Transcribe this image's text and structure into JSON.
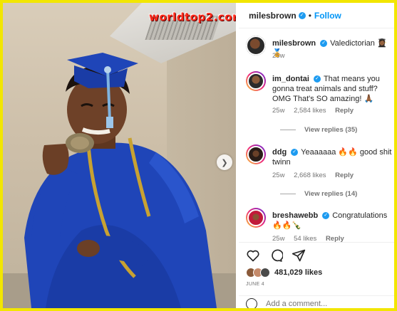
{
  "watermark": "worldtop2.com",
  "post": {
    "author": "milesbrown",
    "follow_label": "Follow",
    "separator": "•"
  },
  "comments": [
    {
      "user": "milesbrown",
      "text": "Valedictorian 👩🏾‍🎓🏅",
      "time": "25w",
      "likes": "",
      "reply": "",
      "view_replies": ""
    },
    {
      "user": "im_dontai",
      "text": "That means you gonna treat animals and stuff? OMG That's SO amazing! 🙏🏾",
      "time": "25w",
      "likes": "2,584 likes",
      "reply": "Reply",
      "view_replies": "View replies (35)"
    },
    {
      "user": "ddg",
      "text": "Yeaaaaaa 🔥🔥 good shit twinn",
      "time": "25w",
      "likes": "2,668 likes",
      "reply": "Reply",
      "view_replies": "View replies (14)"
    },
    {
      "user": "breshawebb",
      "text": "Congratulations 🔥🔥🍾",
      "time": "25w",
      "likes": "54 likes",
      "reply": "Reply",
      "view_replies": ""
    }
  ],
  "actions": {
    "like_icon": "heart-icon",
    "comment_icon": "comment-icon",
    "share_icon": "share-icon"
  },
  "likes_count": "481,029 likes",
  "date": "JUNE 4",
  "add_comment_placeholder": "Add a comment...",
  "colors": {
    "frame": "#f2e600",
    "robe": "#1f45b8",
    "follow": "#0095f6",
    "verified": "#1d9bf0"
  }
}
